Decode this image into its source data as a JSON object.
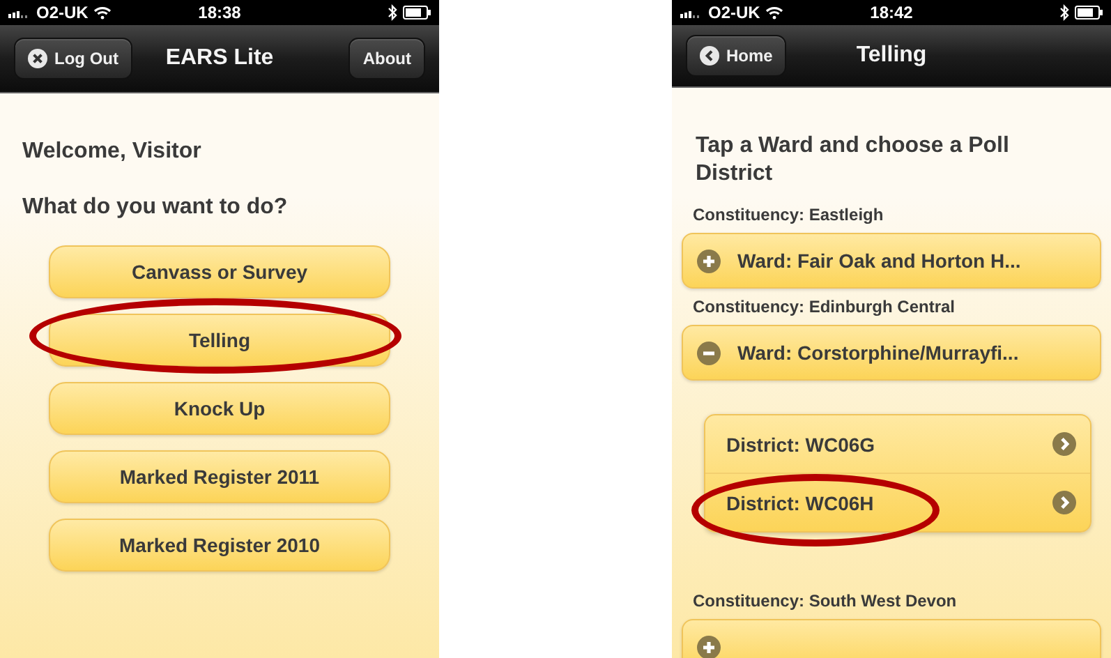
{
  "home_screen": {
    "status_bar": {
      "carrier": "O2-UK",
      "time": "18:38"
    },
    "nav_bar": {
      "left_button": {
        "label": "Log Out",
        "kind": "close"
      },
      "title": "EARS Lite",
      "right_button": {
        "label": "About"
      }
    },
    "welcome": "Welcome, Visitor",
    "prompt": "What do you want to do?",
    "menu": [
      {
        "label": "Canvass or Survey",
        "highlighted": false
      },
      {
        "label": "Telling",
        "highlighted": true
      },
      {
        "label": "Knock Up",
        "highlighted": false
      },
      {
        "label": "Marked Register 2011",
        "highlighted": false
      },
      {
        "label": "Marked Register 2010",
        "highlighted": false
      }
    ]
  },
  "telling_screen": {
    "status_bar": {
      "carrier": "O2-UK",
      "time": "18:42"
    },
    "nav_bar": {
      "left_button": {
        "label": "Home",
        "kind": "back"
      },
      "title": "Telling"
    },
    "heading": "Tap a Ward and choose a Poll District",
    "constituencies": [
      {
        "label": "Constituency: Eastleigh",
        "wards": [
          {
            "label": "Ward: Fair Oak and Horton H...",
            "expanded": false
          }
        ]
      },
      {
        "label": "Constituency: Edinburgh Central",
        "wards": [
          {
            "label": "Ward: Corstorphine/Murrayfi...",
            "expanded": true,
            "children": [
              {
                "label": "District: WC06G",
                "highlighted": false
              },
              {
                "label": "District: WC06H",
                "highlighted": true
              }
            ]
          }
        ]
      },
      {
        "label": "Constituency: South West Devon",
        "wards": [
          {
            "expanded": false
          }
        ]
      }
    ]
  }
}
